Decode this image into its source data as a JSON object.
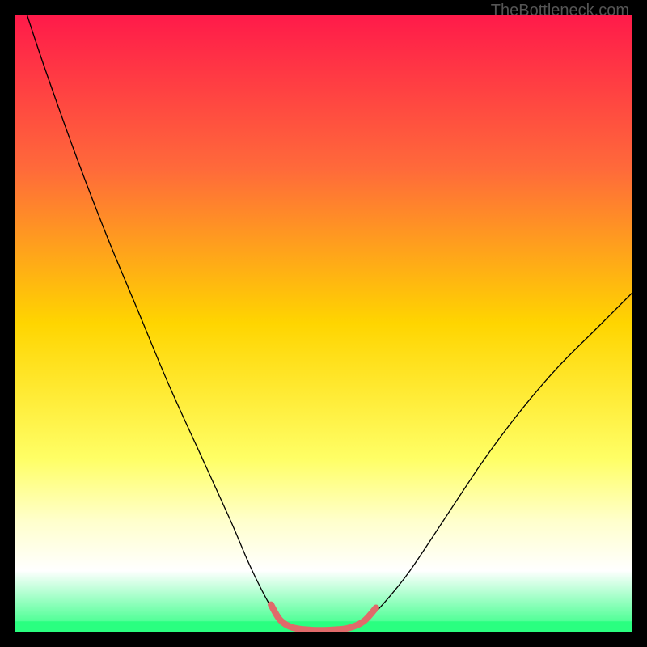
{
  "watermark": "TheBottleneck.com",
  "chart_data": {
    "type": "line",
    "title": "",
    "xlabel": "",
    "ylabel": "",
    "xlim": [
      0,
      100
    ],
    "ylim": [
      0,
      100
    ],
    "background_gradient": {
      "stops": [
        {
          "offset": 0,
          "color": "#ff1a4a"
        },
        {
          "offset": 25,
          "color": "#ff6a3a"
        },
        {
          "offset": 50,
          "color": "#ffd500"
        },
        {
          "offset": 72,
          "color": "#ffff66"
        },
        {
          "offset": 82,
          "color": "#ffffcc"
        },
        {
          "offset": 90,
          "color": "#ffffff"
        },
        {
          "offset": 100,
          "color": "#2aff80"
        }
      ]
    },
    "series": [
      {
        "name": "curve",
        "color": "#000000",
        "width": 1.3,
        "points": [
          {
            "x": 2,
            "y": 100
          },
          {
            "x": 5,
            "y": 91
          },
          {
            "x": 10,
            "y": 77
          },
          {
            "x": 15,
            "y": 64
          },
          {
            "x": 20,
            "y": 52
          },
          {
            "x": 25,
            "y": 40
          },
          {
            "x": 30,
            "y": 29
          },
          {
            "x": 35,
            "y": 18
          },
          {
            "x": 38,
            "y": 11
          },
          {
            "x": 41,
            "y": 5
          },
          {
            "x": 43,
            "y": 2
          },
          {
            "x": 46,
            "y": 0.5
          },
          {
            "x": 50,
            "y": 0.3
          },
          {
            "x": 54,
            "y": 0.5
          },
          {
            "x": 57,
            "y": 2
          },
          {
            "x": 60,
            "y": 5
          },
          {
            "x": 64,
            "y": 10
          },
          {
            "x": 70,
            "y": 19
          },
          {
            "x": 76,
            "y": 28
          },
          {
            "x": 82,
            "y": 36
          },
          {
            "x": 88,
            "y": 43
          },
          {
            "x": 94,
            "y": 49
          },
          {
            "x": 100,
            "y": 55
          }
        ]
      },
      {
        "name": "highlight",
        "color": "#e06a6a",
        "width": 8,
        "points": [
          {
            "x": 41.5,
            "y": 4.5
          },
          {
            "x": 43,
            "y": 2
          },
          {
            "x": 45,
            "y": 0.8
          },
          {
            "x": 48,
            "y": 0.4
          },
          {
            "x": 51,
            "y": 0.4
          },
          {
            "x": 54,
            "y": 0.7
          },
          {
            "x": 56.5,
            "y": 1.8
          },
          {
            "x": 58.5,
            "y": 4
          }
        ]
      }
    ],
    "green_band": {
      "y_top": 1.8,
      "color": "#2aff80"
    }
  }
}
